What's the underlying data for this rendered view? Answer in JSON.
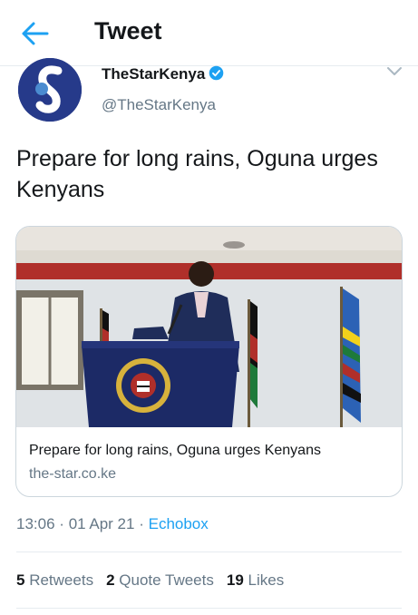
{
  "header": {
    "title": "Tweet"
  },
  "author": {
    "name": "TheStarKenya",
    "handle": "@TheStarKenya"
  },
  "tweet": {
    "text": "Prepare for long rains, Oguna urges Kenyans",
    "card": {
      "title": "Prepare for long rains, Oguna urges Kenyans",
      "domain": "the-star.co.ke",
      "image_alt": "Man speaking at a podium with flags behind him"
    },
    "time": "13:06",
    "date": "01 Apr 21",
    "source": "Echobox"
  },
  "stats": {
    "retweets": {
      "count": "5",
      "label": "Retweets"
    },
    "quotes": {
      "count": "2",
      "label": "Quote Tweets"
    },
    "likes": {
      "count": "19",
      "label": "Likes"
    }
  },
  "colors": {
    "accent": "#1da1f2",
    "secondary_text": "#657786",
    "avatar_bg": "#263a8a"
  }
}
